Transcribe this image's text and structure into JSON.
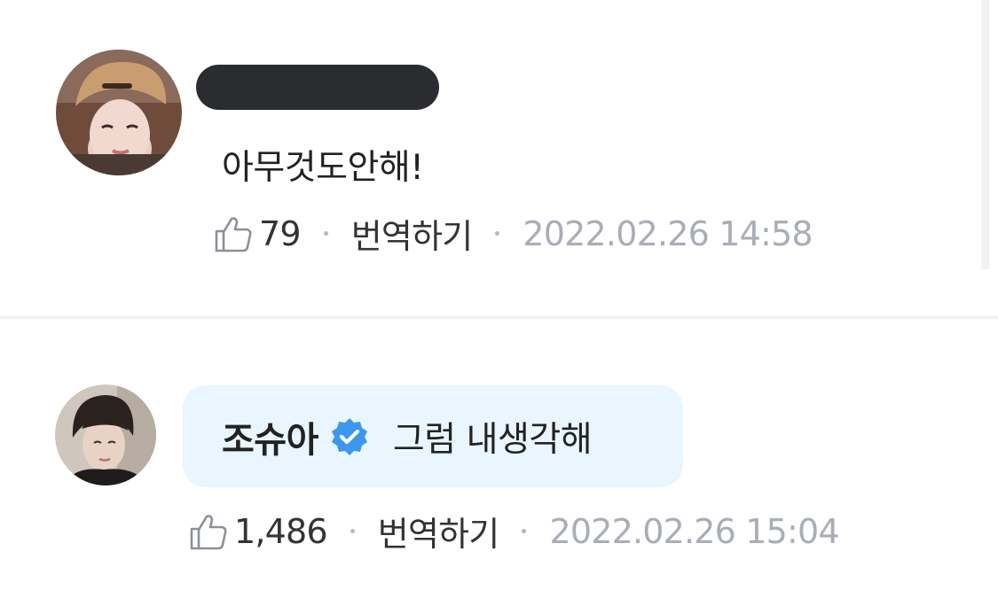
{
  "colors": {
    "bubble_background": "#e9f6ff",
    "verified_badge": "#3d97ee",
    "timestamp_text": "#a9adb6",
    "divider": "#eef0f3"
  },
  "comments": [
    {
      "author": "",
      "author_redacted": true,
      "text": "아무것도안해!",
      "likes": "79",
      "translate_label": "번역하기",
      "timestamp": "2022.02.26 14:58"
    },
    {
      "author": "조슈아",
      "verified": true,
      "text": "그럼 내생각해",
      "likes": "1,486",
      "translate_label": "번역하기",
      "timestamp": "2022.02.26 15:04"
    }
  ],
  "icons": {
    "like": "thumbs-up-icon",
    "verified": "verified-badge-icon"
  }
}
